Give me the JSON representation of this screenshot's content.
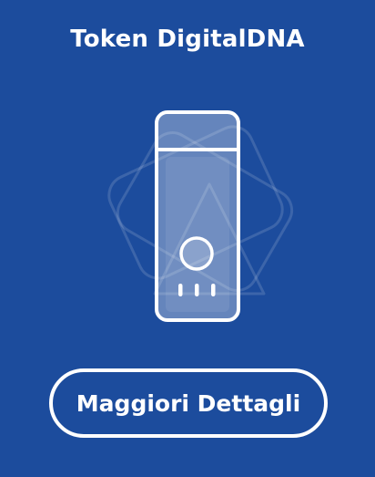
{
  "card": {
    "title": "Token DigitalDNA",
    "illustration_icon": "usb-token-icon",
    "cta_label": "Maggiori Dettagli"
  },
  "colors": {
    "background": "#1c4c9d",
    "foreground": "#ffffff"
  }
}
